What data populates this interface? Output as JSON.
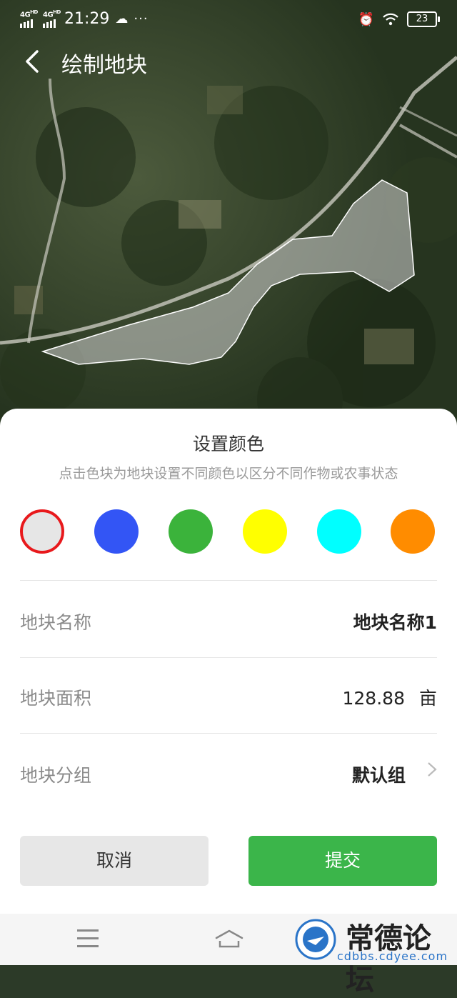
{
  "status_bar": {
    "signal1_label": "4G",
    "signal1_sup": "HD",
    "signal2_label": "4G",
    "signal2_sup": "HD",
    "time": "21:29",
    "more": "···",
    "battery": "23"
  },
  "header": {
    "back_icon": "chevron-left-icon",
    "title": "绘制地块"
  },
  "sheet": {
    "title": "设置颜色",
    "subtitle": "点击色块为地块设置不同颜色以区分不同作物或农事状态",
    "colors": [
      {
        "color": "#e6e6e6",
        "selected": true
      },
      {
        "color": "#3355f5",
        "selected": false
      },
      {
        "color": "#3bb33b",
        "selected": false
      },
      {
        "color": "#ffff00",
        "selected": false
      },
      {
        "color": "#00ffff",
        "selected": false
      },
      {
        "color": "#ff8c00",
        "selected": false
      }
    ],
    "name_label": "地块名称",
    "name_value": "地块名称1",
    "area_label": "地块面积",
    "area_value": "128.88",
    "area_unit": "亩",
    "group_label": "地块分组",
    "group_value": "默认组",
    "cancel_label": "取消",
    "submit_label": "提交"
  },
  "watermark": {
    "name": "常德论坛",
    "url": "cdbbs.cdyee.com"
  },
  "accent_color": "#3bb54a"
}
